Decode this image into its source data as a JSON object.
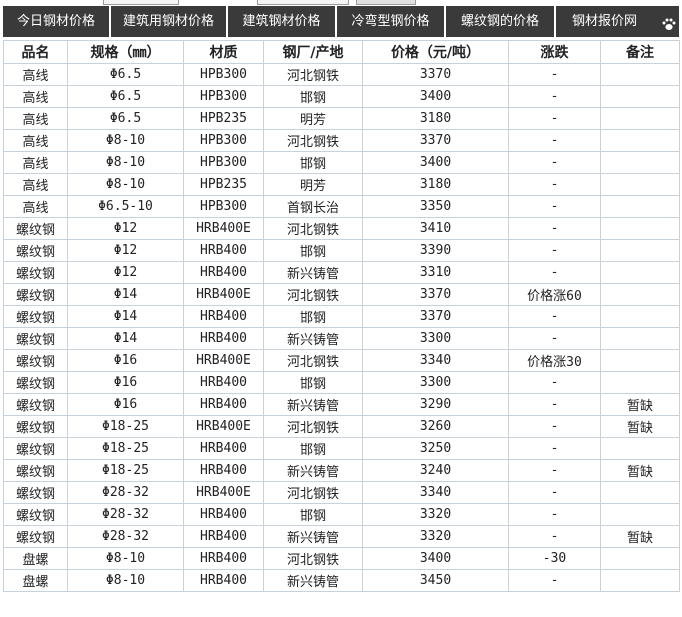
{
  "tabs": [
    {
      "label": "今日钢材价格"
    },
    {
      "label": "建筑用钢材价格"
    },
    {
      "label": "建筑钢材价格"
    },
    {
      "label": "冷弯型钢价格"
    },
    {
      "label": "螺纹钢的价格"
    },
    {
      "label": "钢材报价网"
    }
  ],
  "table": {
    "headers": [
      "品名",
      "规格（㎜）",
      "材质",
      "钢厂/产地",
      "价格（元/吨）",
      "涨跌",
      "备注"
    ],
    "rows": [
      {
        "name": "高线",
        "spec": "Φ6.5",
        "material": "HPB300",
        "origin": "河北钢铁",
        "origin_link": true,
        "price": "3370",
        "change": "-",
        "note": ""
      },
      {
        "name": "高线",
        "spec": "Φ6.5",
        "material": "HPB300",
        "origin": "邯钢",
        "origin_link": false,
        "price": "3400",
        "change": "-",
        "note": ""
      },
      {
        "name": "高线",
        "spec": "Φ6.5",
        "material": "HPB235",
        "origin": "明芳",
        "origin_link": false,
        "price": "3180",
        "change": "-",
        "note": ""
      },
      {
        "name": "高线",
        "spec": "Φ8-10",
        "material": "HPB300",
        "origin": "河北钢铁",
        "origin_link": true,
        "price": "3370",
        "change": "-",
        "note": ""
      },
      {
        "name": "高线",
        "spec": "Φ8-10",
        "material": "HPB300",
        "origin": "邯钢",
        "origin_link": false,
        "price": "3400",
        "change": "-",
        "note": ""
      },
      {
        "name": "高线",
        "spec": "Φ8-10",
        "material": "HPB235",
        "origin": "明芳",
        "origin_link": false,
        "price": "3180",
        "change": "-",
        "note": ""
      },
      {
        "name": "高线",
        "spec": "Φ6.5-10",
        "material": "HPB300",
        "origin": "首钢长治",
        "origin_link": true,
        "price": "3350",
        "change": "-",
        "note": ""
      },
      {
        "name": "螺纹钢",
        "spec": "Φ12",
        "material": "HRB400E",
        "origin": "河北钢铁",
        "origin_link": false,
        "price": "3410",
        "change": "-",
        "note": ""
      },
      {
        "name": "螺纹钢",
        "spec": "Φ12",
        "material": "HRB400",
        "origin": "邯钢",
        "origin_link": false,
        "price": "3390",
        "change": "-",
        "note": ""
      },
      {
        "name": "螺纹钢",
        "spec": "Φ12",
        "material": "HRB400",
        "origin": "新兴铸管",
        "origin_link": true,
        "price": "3310",
        "change": "-",
        "note": ""
      },
      {
        "name": "螺纹钢",
        "spec": "Φ14",
        "material": "HRB400E",
        "origin": "河北钢铁",
        "origin_link": false,
        "price": "3370",
        "change": "价格涨60",
        "note": ""
      },
      {
        "name": "螺纹钢",
        "spec": "Φ14",
        "material": "HRB400",
        "origin": "邯钢",
        "origin_link": false,
        "price": "3370",
        "change": "-",
        "note": ""
      },
      {
        "name": "螺纹钢",
        "spec": "Φ14",
        "material": "HRB400",
        "origin": "新兴铸管",
        "origin_link": false,
        "price": "3300",
        "change": "-",
        "note": ""
      },
      {
        "name": "螺纹钢",
        "spec": "Φ16",
        "material": "HRB400E",
        "origin": "河北钢铁",
        "origin_link": false,
        "price": "3340",
        "change": "价格涨30",
        "note": ""
      },
      {
        "name": "螺纹钢",
        "spec": "Φ16",
        "material": "HRB400",
        "origin": "邯钢",
        "origin_link": false,
        "price": "3300",
        "change": "-",
        "note": ""
      },
      {
        "name": "螺纹钢",
        "spec": "Φ16",
        "material": "HRB400",
        "origin": "新兴铸管",
        "origin_link": false,
        "price": "3290",
        "change": "-",
        "note": "暂缺"
      },
      {
        "name": "螺纹钢",
        "spec": "Φ18-25",
        "material": "HRB400E",
        "origin": "河北钢铁",
        "origin_link": false,
        "price": "3260",
        "change": "-",
        "note": "暂缺"
      },
      {
        "name": "螺纹钢",
        "spec": "Φ18-25",
        "material": "HRB400",
        "origin": "邯钢",
        "origin_link": false,
        "price": "3250",
        "change": "-",
        "note": ""
      },
      {
        "name": "螺纹钢",
        "spec": "Φ18-25",
        "material": "HRB400",
        "origin": "新兴铸管",
        "origin_link": false,
        "price": "3240",
        "change": "-",
        "note": "暂缺"
      },
      {
        "name": "螺纹钢",
        "spec": "Φ28-32",
        "material": "HRB400E",
        "origin": "河北钢铁",
        "origin_link": false,
        "price": "3340",
        "change": "-",
        "note": ""
      },
      {
        "name": "螺纹钢",
        "spec": "Φ28-32",
        "material": "HRB400",
        "origin": "邯钢",
        "origin_link": false,
        "price": "3320",
        "change": "-",
        "note": ""
      },
      {
        "name": "螺纹钢",
        "spec": "Φ28-32",
        "material": "HRB400",
        "origin": "新兴铸管",
        "origin_link": false,
        "price": "3320",
        "change": "-",
        "note": "暂缺"
      },
      {
        "name": "盘螺",
        "spec": "Φ8-10",
        "material": "HRB400",
        "origin": "河北钢铁",
        "origin_link": false,
        "price": "3400",
        "change": "-30",
        "note": ""
      },
      {
        "name": "盘螺",
        "spec": "Φ8-10",
        "material": "HRB400",
        "origin": "新兴铸管",
        "origin_link": false,
        "price": "3450",
        "change": "-",
        "note": ""
      }
    ]
  },
  "colors": {
    "tab_bar": "#3a3a3a",
    "link_blue": "#1b2fa8",
    "border": "#c9d2dc"
  },
  "icons": {
    "corner_icon": "paw-icon"
  }
}
